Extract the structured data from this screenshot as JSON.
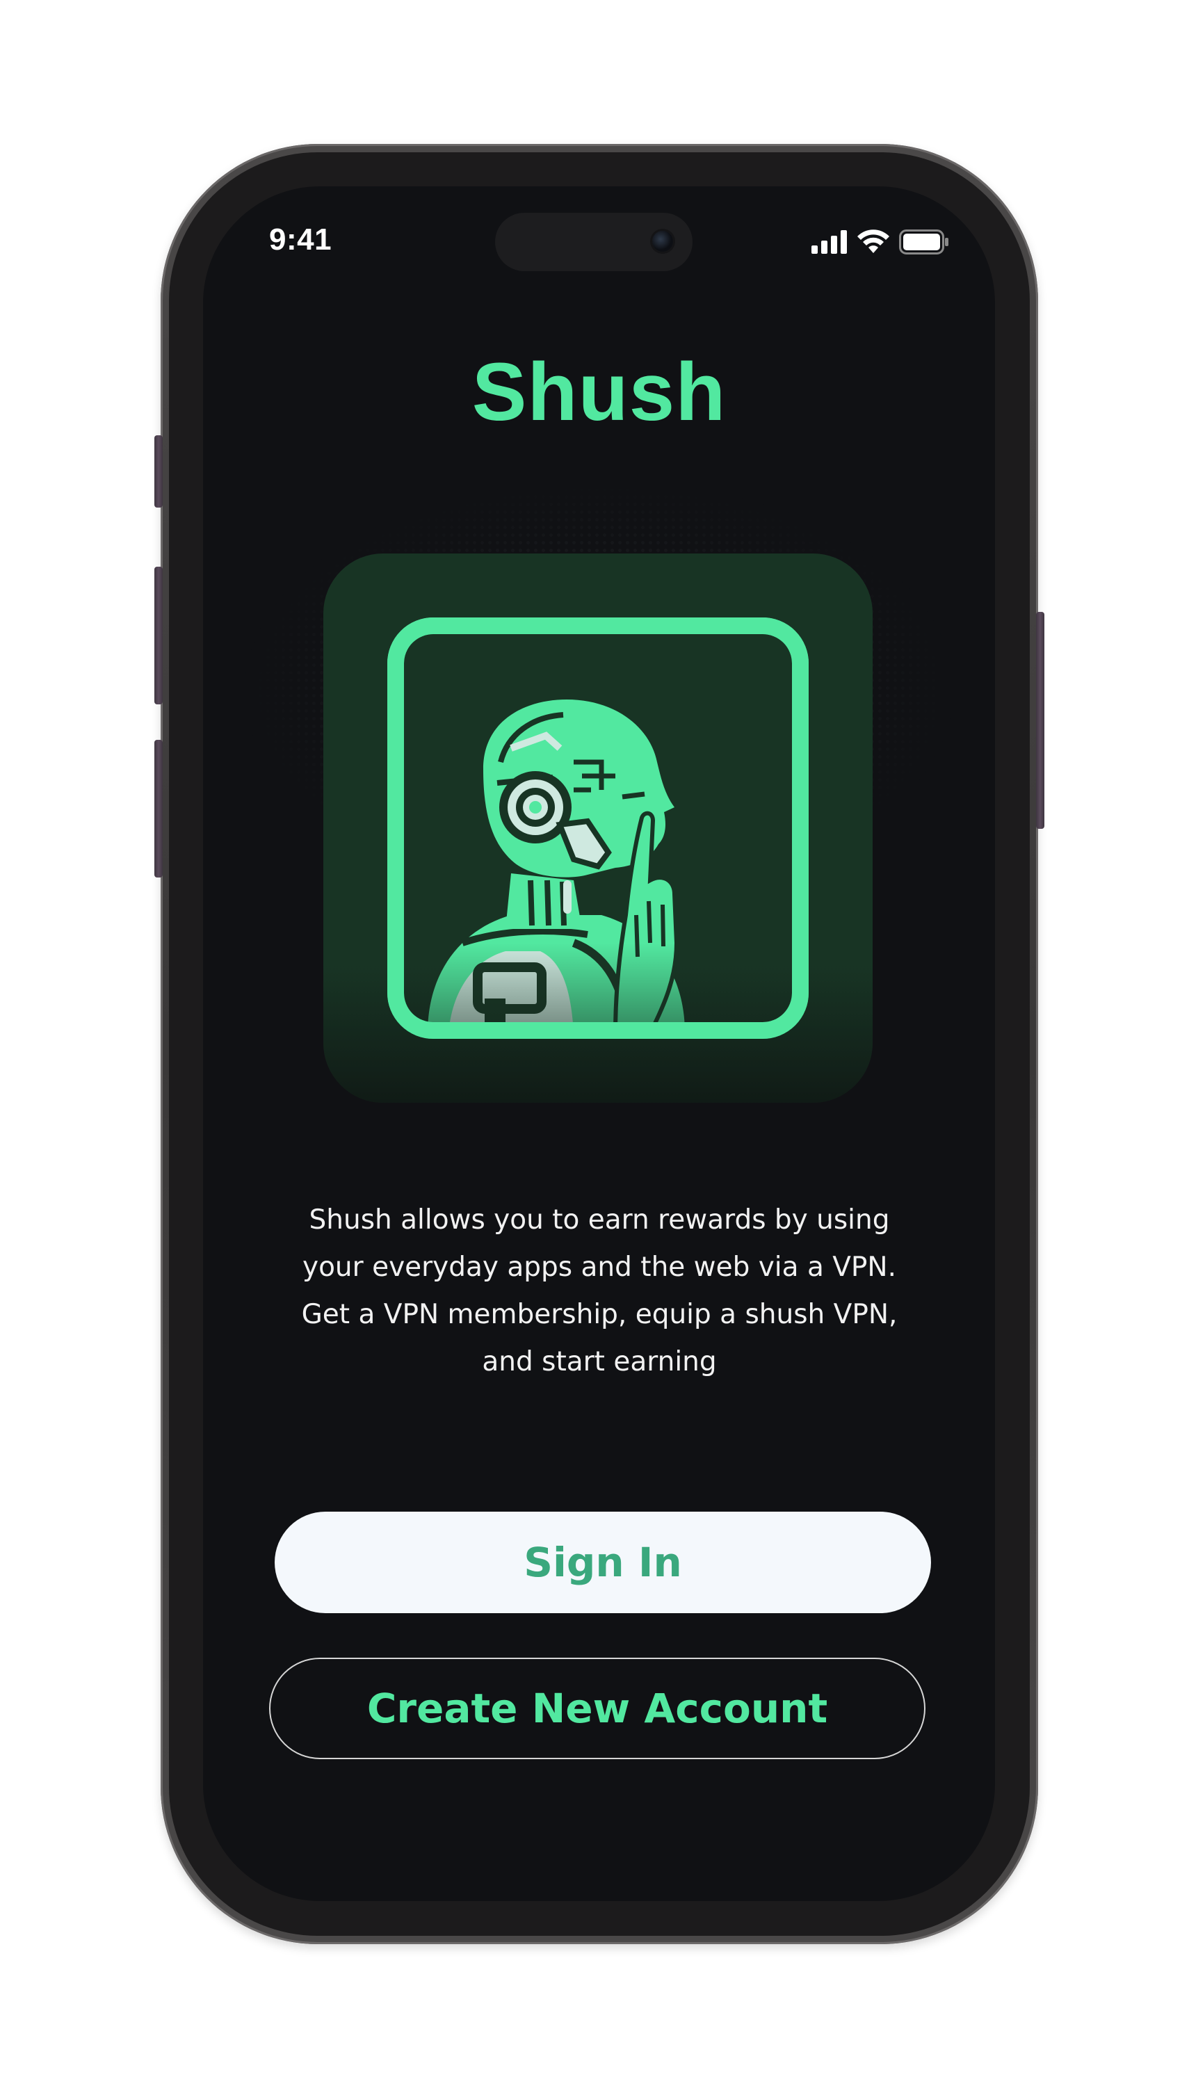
{
  "status_bar": {
    "time": "9:41",
    "icons": [
      "cellular-signal-icon",
      "wifi-icon",
      "battery-icon"
    ]
  },
  "app": {
    "title": "Shush",
    "logo_icon": "robot-shush-icon",
    "description": "Shush allows you to earn rewards by using your everyday apps and the web via a VPN. Get a VPN membership, equip a shush VPN, and start earning"
  },
  "actions": {
    "sign_in_label": "Sign In",
    "create_account_label": "Create New Account"
  },
  "colors": {
    "accent": "#52e8a0",
    "background": "#101114",
    "tile": "#183424",
    "sign_in_bg": "#f4f8fc",
    "sign_in_text": "#3aa87d"
  }
}
